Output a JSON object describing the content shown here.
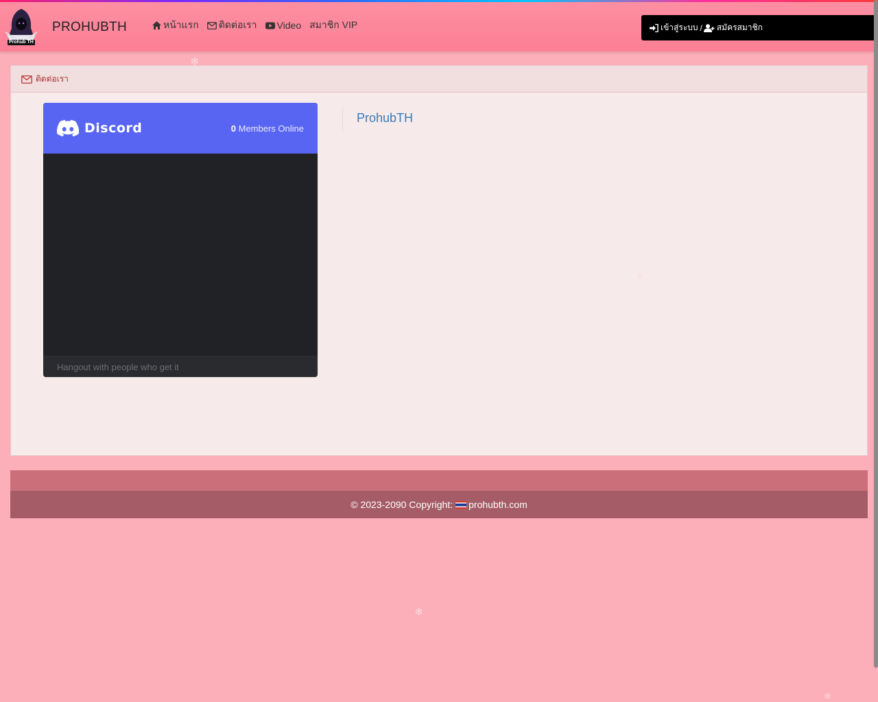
{
  "header": {
    "brand": "PROHUBTH",
    "logo_text": "Prohub TH",
    "nav": [
      {
        "label": "หน้าแรก",
        "icon": "home-icon"
      },
      {
        "label": "ติดต่อเรา",
        "icon": "envelope-icon"
      },
      {
        "label": "Video",
        "icon": "youtube-icon"
      },
      {
        "label": "สมาชิก VIP",
        "icon": ""
      }
    ],
    "login_label": "เข้าสู่ระบบ",
    "register_label": "สมัครสมาชิก",
    "separator": "/"
  },
  "panel": {
    "title": "ติดต่อเรา"
  },
  "discord": {
    "brand": "Discord",
    "members_count": "0",
    "members_label": "Members Online",
    "footer_text": "Hangout with people who get it"
  },
  "side": {
    "link": "ProhubTH"
  },
  "footer": {
    "copyright": "© 2023-2090 Copyright:",
    "site": "prohubth.com"
  },
  "colors": {
    "background": "#fcaeb9",
    "navbar": "#fc8499",
    "discord_blurple": "#5865f2",
    "footer": "#a55c66"
  }
}
